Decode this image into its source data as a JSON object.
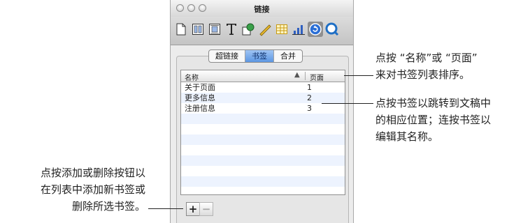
{
  "window": {
    "title": "链接"
  },
  "toolbar": {
    "icons": [
      "document-icon",
      "layout-icon",
      "wrap-icon",
      "text-icon",
      "graphic-icon",
      "metrics-icon",
      "table-icon",
      "chart-icon",
      "link-icon",
      "quicktime-icon"
    ],
    "selected": "link-icon"
  },
  "tabs": {
    "hyperlink": "超链接",
    "bookmark": "书签",
    "merge": "合并",
    "active": "bookmark"
  },
  "table": {
    "columns": {
      "name": "名称",
      "sort_arrow": "▲",
      "page": "页面"
    },
    "rows": [
      {
        "name": "关于页面",
        "page": "1"
      },
      {
        "name": "更多信息",
        "page": "2"
      },
      {
        "name": "注册信息",
        "page": "3"
      }
    ]
  },
  "buttons": {
    "add": "+",
    "remove": "−"
  },
  "callouts": {
    "sort": [
      "点按 “名称”或 “页面”",
      "来对书签列表排序。"
    ],
    "jump": [
      "点按书签以跳转到文稿中",
      "的相应位置；连按书签以",
      "编辑其名称。"
    ],
    "addremove": [
      "点按添加或删除按钮以",
      "在列表中添加新书签或",
      "删除所选书签。"
    ]
  }
}
